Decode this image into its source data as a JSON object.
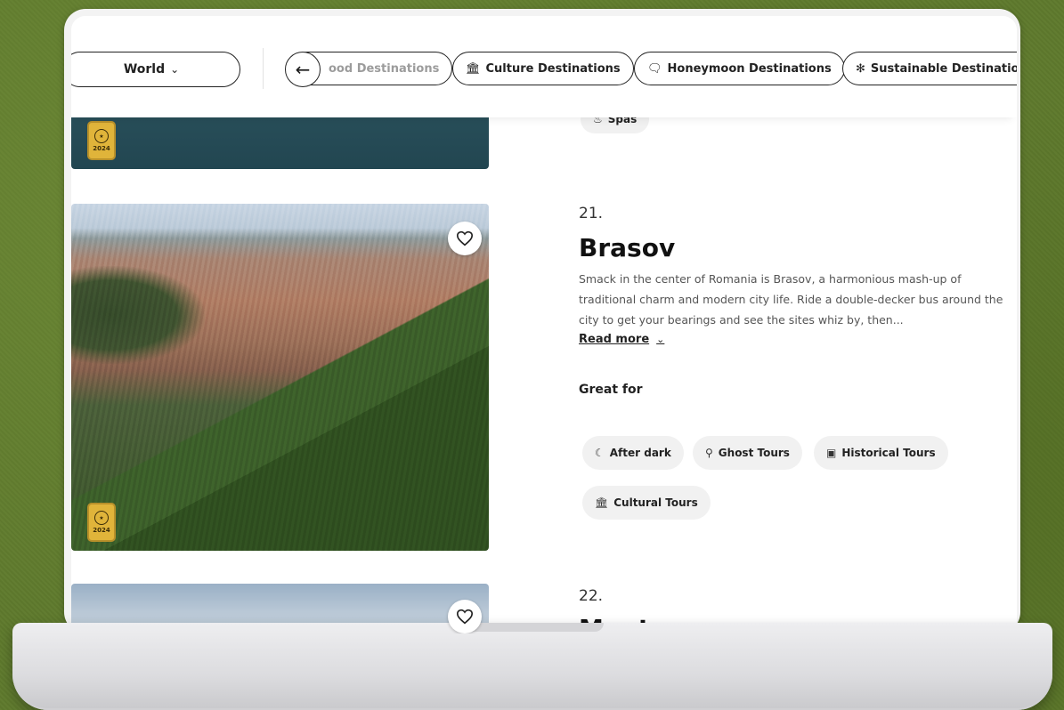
{
  "filters": {
    "region": "World",
    "pills": [
      {
        "label": "ood Destinations",
        "icon": ""
      },
      {
        "label": "Culture Destinations",
        "icon": "museum-icon"
      },
      {
        "label": "Honeymoon Destinations",
        "icon": "chat-heart-icon"
      },
      {
        "label": "Sustainable Destinatio",
        "icon": "leaf-icon"
      }
    ]
  },
  "prev_entry": {
    "tags": [
      {
        "label": "Spas",
        "icon": "spa-icon"
      }
    ],
    "badge_year": "2024"
  },
  "entry": {
    "rank": "21.",
    "name": "Brasov",
    "description": "Smack in the center of Romania is Brasov, a harmonious mash-up of traditional charm and modern city life. Ride a double-decker bus around the city to get your bearings and see the sites whiz by, then...",
    "read_more": "Read more",
    "great_for_label": "Great for",
    "badge_year": "2024",
    "tags": [
      {
        "label": "After dark",
        "icon": "moon-sparkle-icon"
      },
      {
        "label": "Ghost Tours",
        "icon": "map-pin-icon"
      },
      {
        "label": "Historical Tours",
        "icon": "camera-icon"
      },
      {
        "label": "Cultural Tours",
        "icon": "museum-icon"
      }
    ]
  },
  "next_entry": {
    "rank": "22.",
    "name": "Manta"
  }
}
